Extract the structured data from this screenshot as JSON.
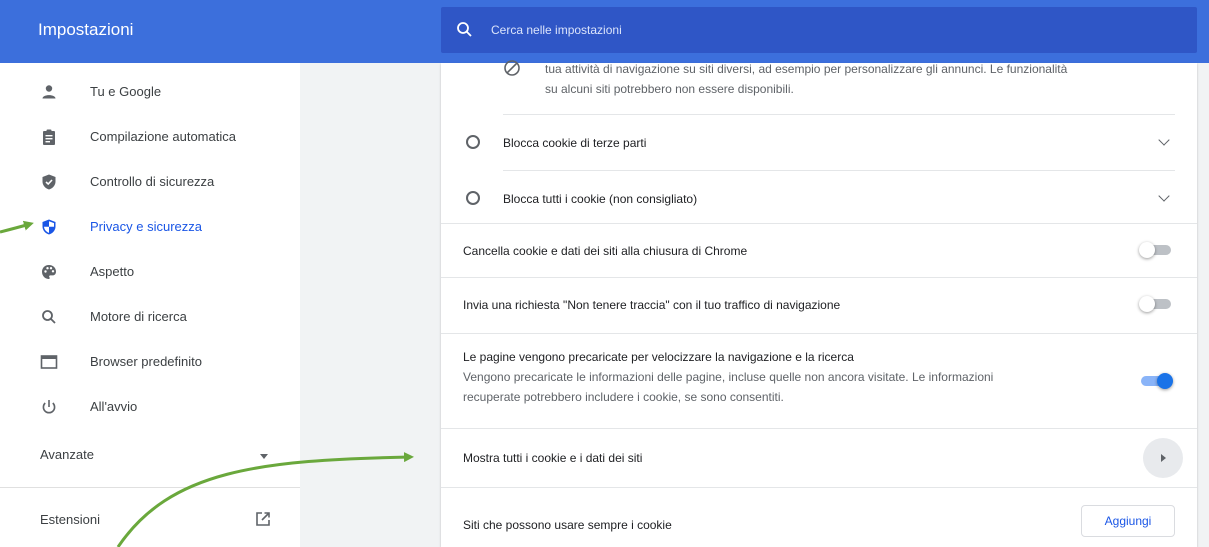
{
  "header": {
    "title": "Impostazioni",
    "search_placeholder": "Cerca nelle impostazioni"
  },
  "sidebar": {
    "items": [
      {
        "label": "Tu e Google",
        "icon": "person-icon"
      },
      {
        "label": "Compilazione automatica",
        "icon": "clipboard-icon"
      },
      {
        "label": "Controllo di sicurezza",
        "icon": "shield-check-icon"
      },
      {
        "label": "Privacy e sicurezza",
        "icon": "privacy-shield-icon",
        "active": true
      },
      {
        "label": "Aspetto",
        "icon": "palette-icon"
      },
      {
        "label": "Motore di ricerca",
        "icon": "search-icon"
      },
      {
        "label": "Browser predefinito",
        "icon": "browser-window-icon"
      },
      {
        "label": "All'avvio",
        "icon": "power-icon"
      }
    ],
    "advanced_label": "Avanzate",
    "extensions_label": "Estensioni"
  },
  "content": {
    "partial_line_1": "tua attività di navigazione su siti diversi, ad esempio per personalizzare gli annunci. Le funzionalità",
    "partial_line_2": "su alcuni siti potrebbero non essere disponibili.",
    "block_third_party": "Blocca cookie di terze parti",
    "block_all": "Blocca tutti i cookie (non consigliato)",
    "clear_on_exit": "Cancella cookie e dati dei siti alla chiusura di Chrome",
    "do_not_track": "Invia una richiesta \"Non tenere traccia\" con il tuo traffico di navigazione",
    "preload_title": "Le pagine vengono precaricate per velocizzare la navigazione e la ricerca",
    "preload_desc_1": "Vengono precaricate le informazioni delle pagine, incluse quelle non ancora visitate. Le informazioni",
    "preload_desc_2": "recuperate potrebbero includere i cookie, se sono consentiti.",
    "show_all_cookies": "Mostra tutti i cookie e i dati dei siti",
    "always_allow": "Siti che possono usare sempre i cookie",
    "add_button": "Aggiungi"
  },
  "toggles": {
    "clear_on_exit": false,
    "do_not_track": false,
    "preload": true
  },
  "colors": {
    "header_blue": "#3c6fdc",
    "search_blue": "#2f56c6",
    "accent_blue": "#1a73e8",
    "annotation_green": "#6aa83c"
  }
}
